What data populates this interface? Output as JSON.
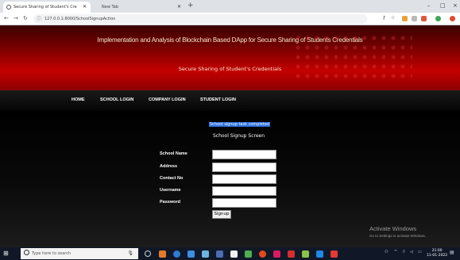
{
  "browser": {
    "tabs": [
      {
        "label": "Secure Sharing of Student's Cre",
        "active": true
      },
      {
        "label": "New Tab",
        "active": false
      }
    ],
    "new_tab_symbol": "+",
    "url": "127.0.0.1:8000/SchoolSignupAction",
    "window_controls": [
      "–",
      "□",
      "×"
    ]
  },
  "site": {
    "title": "Implementation and Analysis of Blockchain Based DApp for Secure Sharing of Students Credentials",
    "subtitle": "Secure Sharing of Student's Credentials",
    "menu": [
      "HOME",
      "SCHOOL LOGIN",
      "COMPANY LOGIN",
      "STUDENT LOGIN"
    ]
  },
  "form": {
    "status_message": "School signup task completed",
    "title": "School Signup Screen",
    "fields": [
      {
        "label": "School Name",
        "value": ""
      },
      {
        "label": "Address",
        "value": ""
      },
      {
        "label": "Contact No",
        "value": ""
      },
      {
        "label": "Username",
        "value": ""
      },
      {
        "label": "Password",
        "value": ""
      }
    ],
    "submit_label": "Signup"
  },
  "watermark": {
    "title": "Activate Windows",
    "subtitle": "Go to Settings to activate Windows."
  },
  "taskbar": {
    "search_placeholder": "Type here to search",
    "time": "21:00",
    "date": "11-01-2022"
  },
  "colors": {
    "header_red": "#c40000",
    "header_dark": "#3a0000",
    "status_highlight": "#2a6fdb",
    "taskbar": "#101828"
  }
}
